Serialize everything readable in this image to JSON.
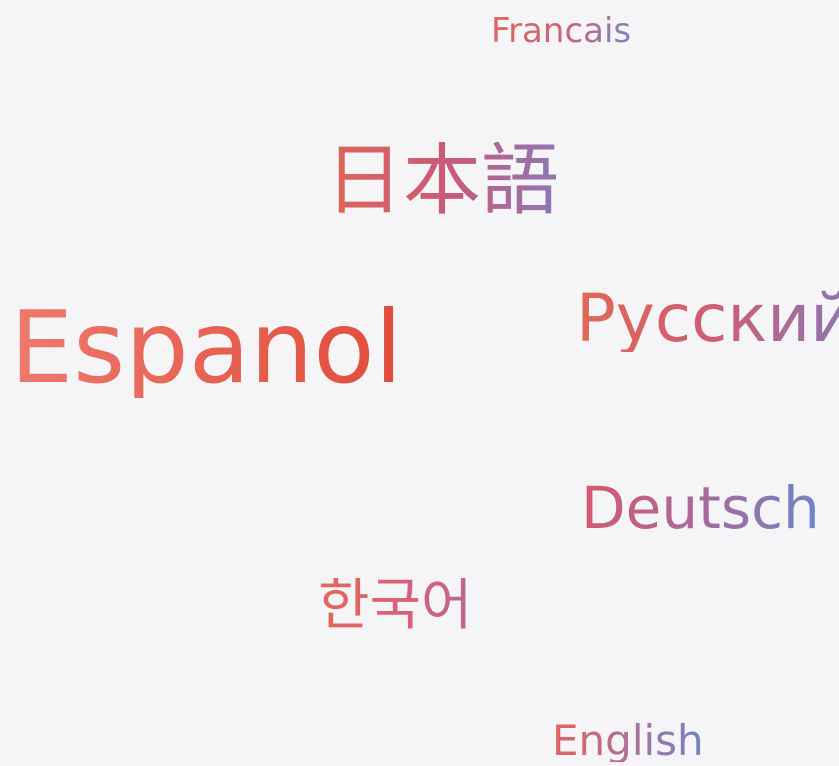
{
  "words": {
    "francais": "Francais",
    "japanese": "日本語",
    "espanol": "Espanol",
    "russian": "Русский",
    "deutsch": "Deutsch",
    "korean": "한국어",
    "english": "English"
  },
  "colors": {
    "background": "#f5f4f7",
    "red": "#e24b3a",
    "pink": "#c95a7a",
    "blue": "#6b87c6",
    "purple": "#8a78b6"
  }
}
